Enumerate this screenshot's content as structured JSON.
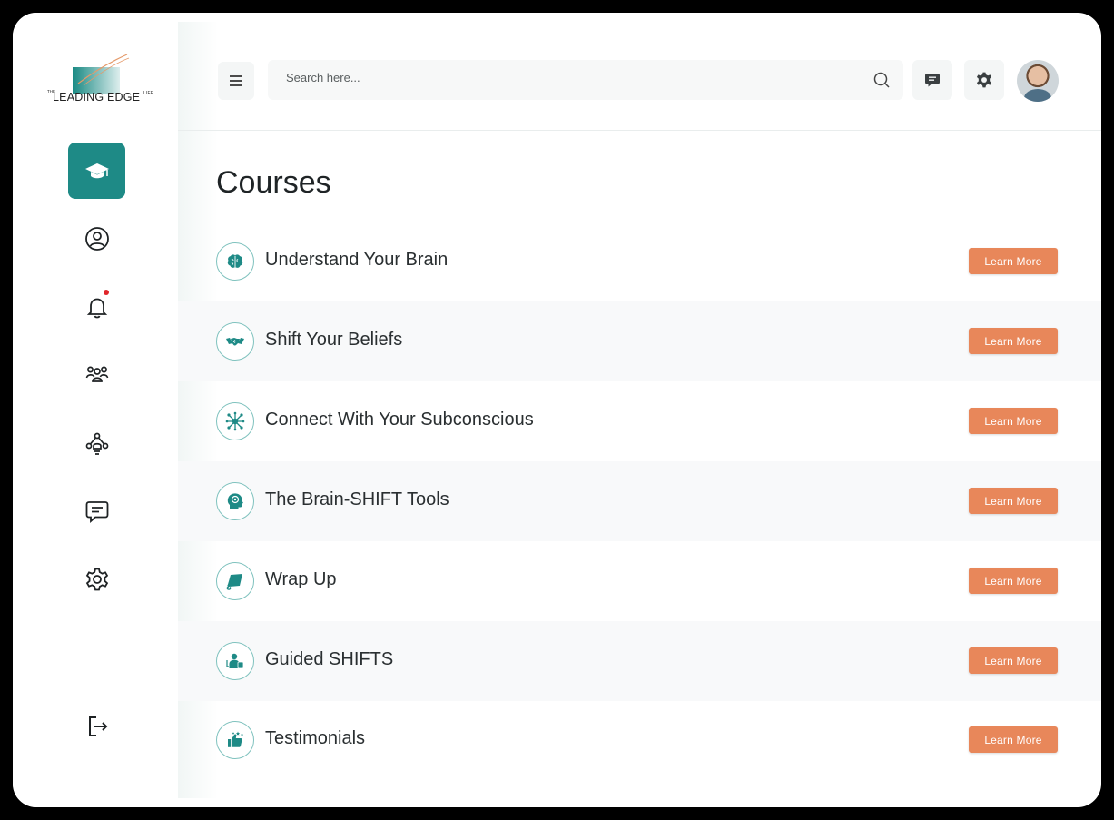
{
  "brand": {
    "logo_prefix": "THE",
    "logo_text": "LEADING EDGE",
    "logo_suffix": "LIFE"
  },
  "sidebar": {
    "items": [
      {
        "name": "courses",
        "icon": "graduation-cap-icon",
        "active": true
      },
      {
        "name": "profile",
        "icon": "user-circle-icon"
      },
      {
        "name": "notifications",
        "icon": "bell-icon",
        "badge": true
      },
      {
        "name": "community",
        "icon": "group-icon"
      },
      {
        "name": "network",
        "icon": "hierarchy-icon"
      },
      {
        "name": "messages",
        "icon": "chat-icon"
      },
      {
        "name": "settings",
        "icon": "gear-icon"
      }
    ],
    "logout_icon": "logout-icon"
  },
  "header": {
    "search_placeholder": "Search here...",
    "menu_icon": "hamburger-icon",
    "chat_icon": "chat-bubble-icon",
    "settings_icon": "gear-icon"
  },
  "main": {
    "title": "Courses",
    "button_label": "Learn More",
    "courses": [
      {
        "title": "Understand Your Brain",
        "icon": "brain-icon"
      },
      {
        "title": "Shift Your Beliefs",
        "icon": "handshake-icon"
      },
      {
        "title": "Connect With Your Subconscious",
        "icon": "network-icon"
      },
      {
        "title": "The Brain-SHIFT Tools",
        "icon": "head-gear-icon"
      },
      {
        "title": "Wrap Up",
        "icon": "scroll-icon"
      },
      {
        "title": "Guided SHIFTS",
        "icon": "guide-icon"
      },
      {
        "title": "Testimonials",
        "icon": "thumbs-up-icon"
      }
    ]
  },
  "colors": {
    "accent": "#1e8a86",
    "button": "#e8875a",
    "row_alt": "#f8f9fa"
  }
}
